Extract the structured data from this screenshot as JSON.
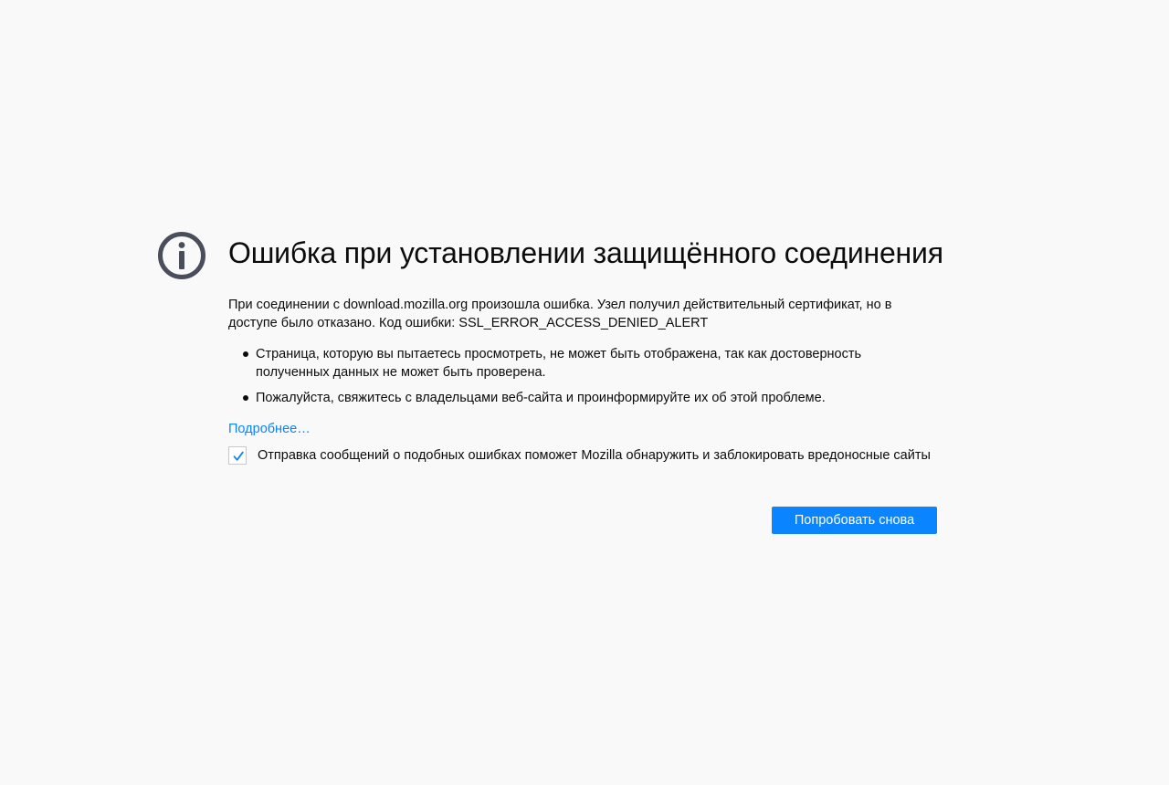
{
  "error": {
    "title": "Ошибка при установлении защищённого соединения",
    "description": "При соединении с download.mozilla.org произошла ошибка. Узел получил действительный сертификат, но в доступе было отказано. Код ошибки: SSL_ERROR_ACCESS_DENIED_ALERT",
    "bullets": [
      "Страница, которую вы пытаетесь просмотреть, не может быть отображена, так как достоверность полученных данных не может быть проверена.",
      "Пожалуйста, свяжитесь с владельцами веб-сайта и проинформируйте их об этой проблеме."
    ],
    "learn_more": "Подробнее…",
    "report": {
      "checked": true,
      "label": "Отправка сообщений о подобных ошибках поможет Mozilla обнаружить и заблокировать вредоносные сайты"
    },
    "retry_label": "Попробовать снова"
  },
  "icons": {
    "main": "info-icon",
    "check": "checkmark-icon"
  },
  "colors": {
    "background": "#f9f9fa",
    "accent": "#0a84ff",
    "icon": "#4a4e5a",
    "text": "#0c0c0d"
  }
}
